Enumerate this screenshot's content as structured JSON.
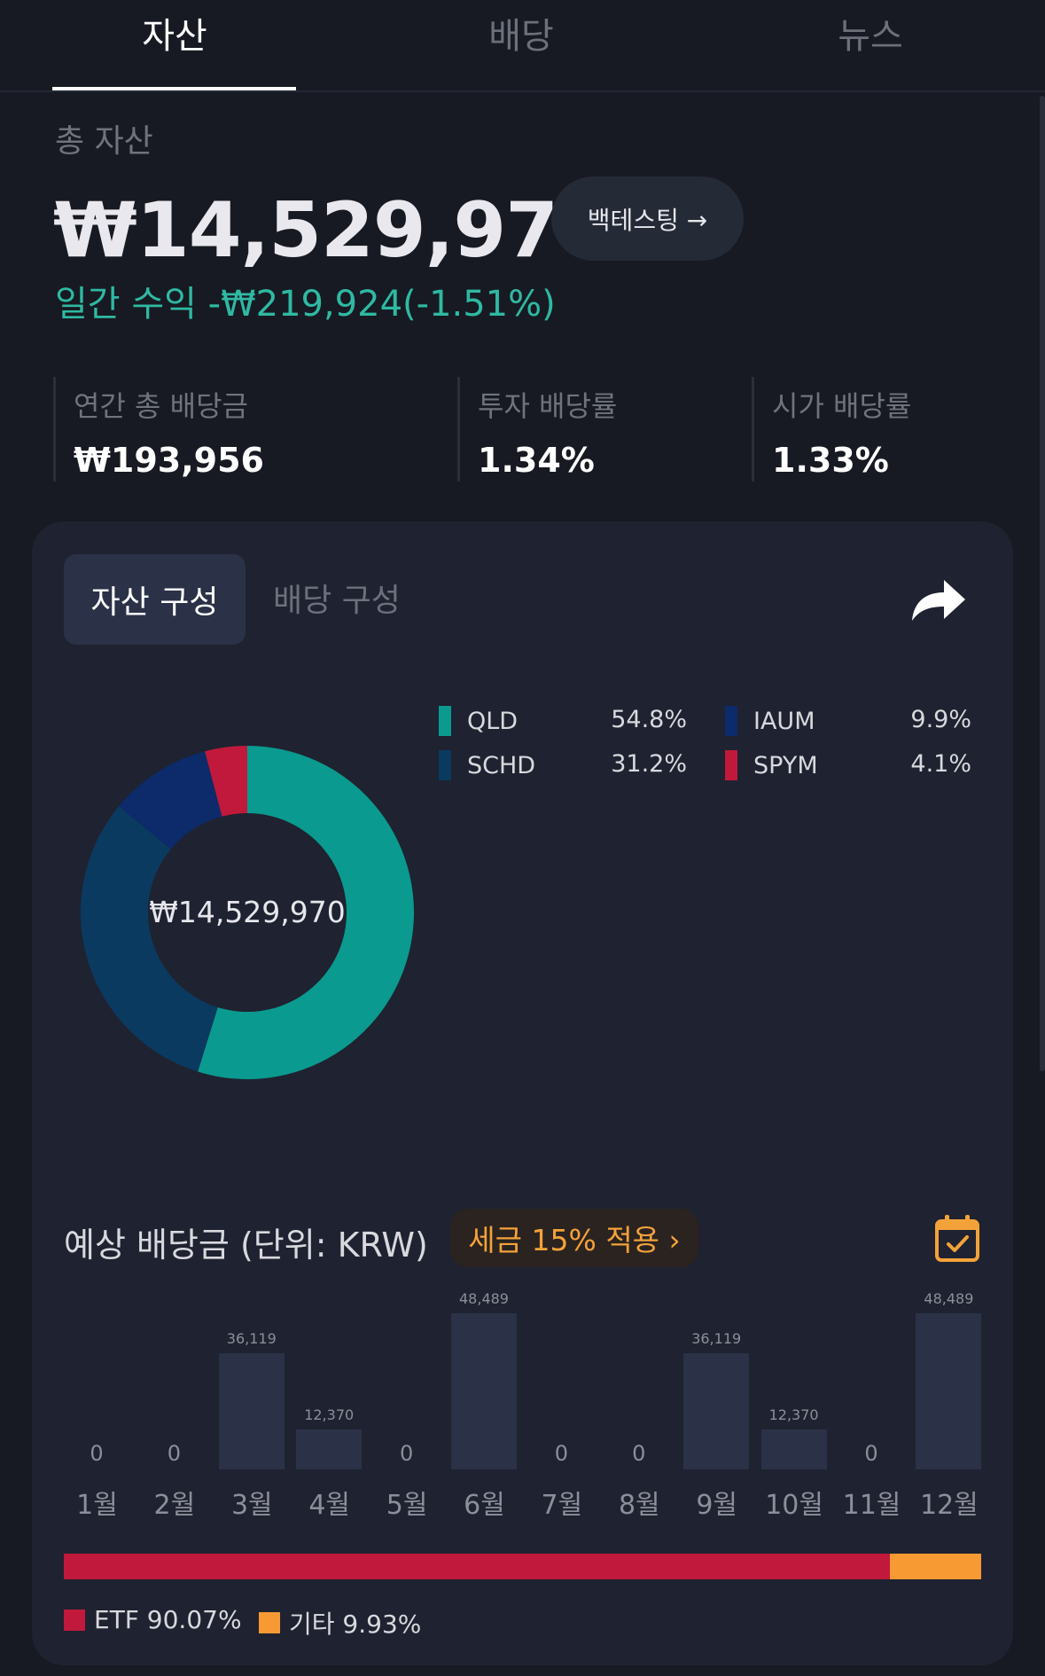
{
  "tabs": [
    "자산",
    "배당",
    "뉴스"
  ],
  "summary": {
    "label": "총 자산",
    "total": "₩14,529,970",
    "backtest_label": "백테스팅 →",
    "daily": "일간 수익 -₩219,924(-1.51%)"
  },
  "stats": [
    {
      "label": "연간 총 배당금",
      "value": "₩193,956"
    },
    {
      "label": "투자 배당률",
      "value": "1.34%"
    },
    {
      "label": "시가 배당률",
      "value": "1.33%"
    }
  ],
  "card": {
    "seg_active": "자산 구성",
    "seg_inactive": "배당 구성"
  },
  "allocation": {
    "center": "₩14,529,970",
    "items": [
      {
        "name": "QLD",
        "pct": "54.8%",
        "value": 54.8,
        "color": "#0a9a8f"
      },
      {
        "name": "SCHD",
        "pct": "31.2%",
        "value": 31.2,
        "color": "#0b3a60"
      },
      {
        "name": "IAUM",
        "pct": "9.9%",
        "value": 9.9,
        "color": "#0d2a6b"
      },
      {
        "name": "SPYM",
        "pct": "4.1%",
        "value": 4.1,
        "color": "#c1193b"
      }
    ]
  },
  "dividend": {
    "title": "예상 배당금 (단위: KRW)",
    "tax_label": "세금 15% 적용 ›",
    "months": [
      "1월",
      "2월",
      "3월",
      "4월",
      "5월",
      "6월",
      "7월",
      "8월",
      "9월",
      "10월",
      "11월",
      "12월"
    ],
    "values": [
      0,
      0,
      36119,
      12370,
      0,
      48489,
      0,
      0,
      36119,
      12370,
      0,
      48489
    ],
    "value_labels": [
      "0",
      "0",
      "36,119",
      "12,370",
      "0",
      "48,489",
      "0",
      "0",
      "36,119",
      "12,370",
      "0",
      "48,489"
    ],
    "ratio": [
      {
        "label": "ETF 90.07%",
        "value": 90.07,
        "color": "#c1193b"
      },
      {
        "label": "기타 9.93%",
        "value": 9.93,
        "color": "#f79a33"
      }
    ]
  },
  "chart_data": {
    "type": "bar",
    "categories": [
      "1월",
      "2월",
      "3월",
      "4월",
      "5월",
      "6월",
      "7월",
      "8월",
      "9월",
      "10월",
      "11월",
      "12월"
    ],
    "values": [
      0,
      0,
      36119,
      12370,
      0,
      48489,
      0,
      0,
      36119,
      12370,
      0,
      48489
    ],
    "title": "예상 배당금 (단위: KRW)"
  }
}
